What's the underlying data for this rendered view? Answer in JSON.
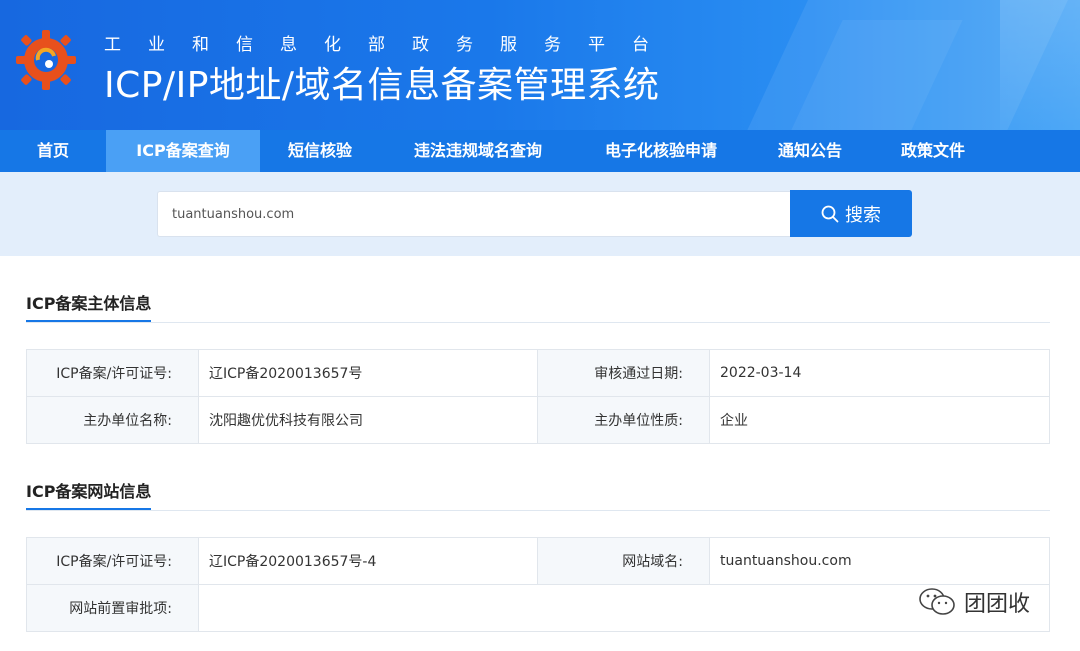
{
  "header": {
    "subtitle": "工业和信息化部政务服务平台",
    "title": "ICP/IP地址/域名信息备案管理系统"
  },
  "nav": {
    "items": [
      {
        "label": "首页"
      },
      {
        "label": "ICP备案查询",
        "active": true
      },
      {
        "label": "短信核验"
      },
      {
        "label": "违法违规域名查询"
      },
      {
        "label": "电子化核验申请"
      },
      {
        "label": "通知公告"
      },
      {
        "label": "政策文件"
      }
    ]
  },
  "search": {
    "value": "tuantuanshou.com",
    "button_label": "搜索",
    "icon": "search-icon"
  },
  "entity_section": {
    "title": "ICP备案主体信息",
    "rows": [
      {
        "label1": "ICP备案/许可证号:",
        "value1": "辽ICP备2020013657号",
        "label2": "审核通过日期:",
        "value2": "2022-03-14"
      },
      {
        "label1": "主办单位名称:",
        "value1": "沈阳趣优优科技有限公司",
        "label2": "主办单位性质:",
        "value2": "企业"
      }
    ]
  },
  "site_section": {
    "title": "ICP备案网站信息",
    "rows": [
      {
        "label1": "ICP备案/许可证号:",
        "value1": "辽ICP备2020013657号-4",
        "label2": "网站域名:",
        "value2": "tuantuanshou.com"
      },
      {
        "label1": "网站前置审批项:",
        "value1": ""
      }
    ]
  },
  "watermark": {
    "text": "团团收",
    "icon": "wechat-icon"
  },
  "colors": {
    "primary": "#1677e6",
    "nav_active": "#4aa0f5",
    "search_bg": "#e3eefb"
  }
}
